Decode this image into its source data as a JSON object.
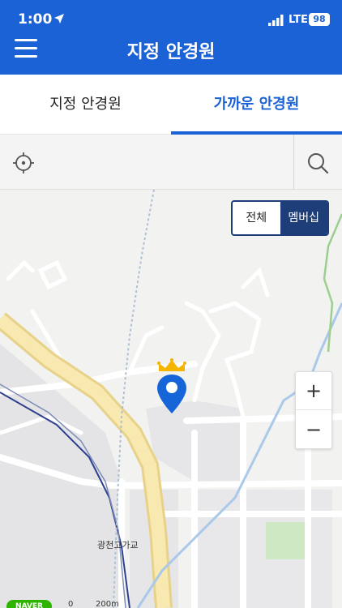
{
  "status": {
    "time": "1:00",
    "network": "LTE",
    "battery": "98"
  },
  "header": {
    "title": "지정 안경원"
  },
  "tabs": [
    {
      "label": "지정 안경원",
      "active": false
    },
    {
      "label": "가까운 안경원",
      "active": true
    }
  ],
  "search": {
    "placeholder": ""
  },
  "filter": {
    "all_label": "전체",
    "member_label": "멤버십",
    "selected": "멤버십"
  },
  "zoom": {
    "in_label": "+",
    "out_label": "−"
  },
  "map": {
    "place_label": "광천고가교",
    "logo_text": "NAVER",
    "scale_start": "0",
    "scale_end": "200m"
  },
  "colors": {
    "primary": "#1a62d6",
    "filter_dark": "#1d3e78",
    "marker": "#1565d8",
    "crown": "#f5b400"
  }
}
